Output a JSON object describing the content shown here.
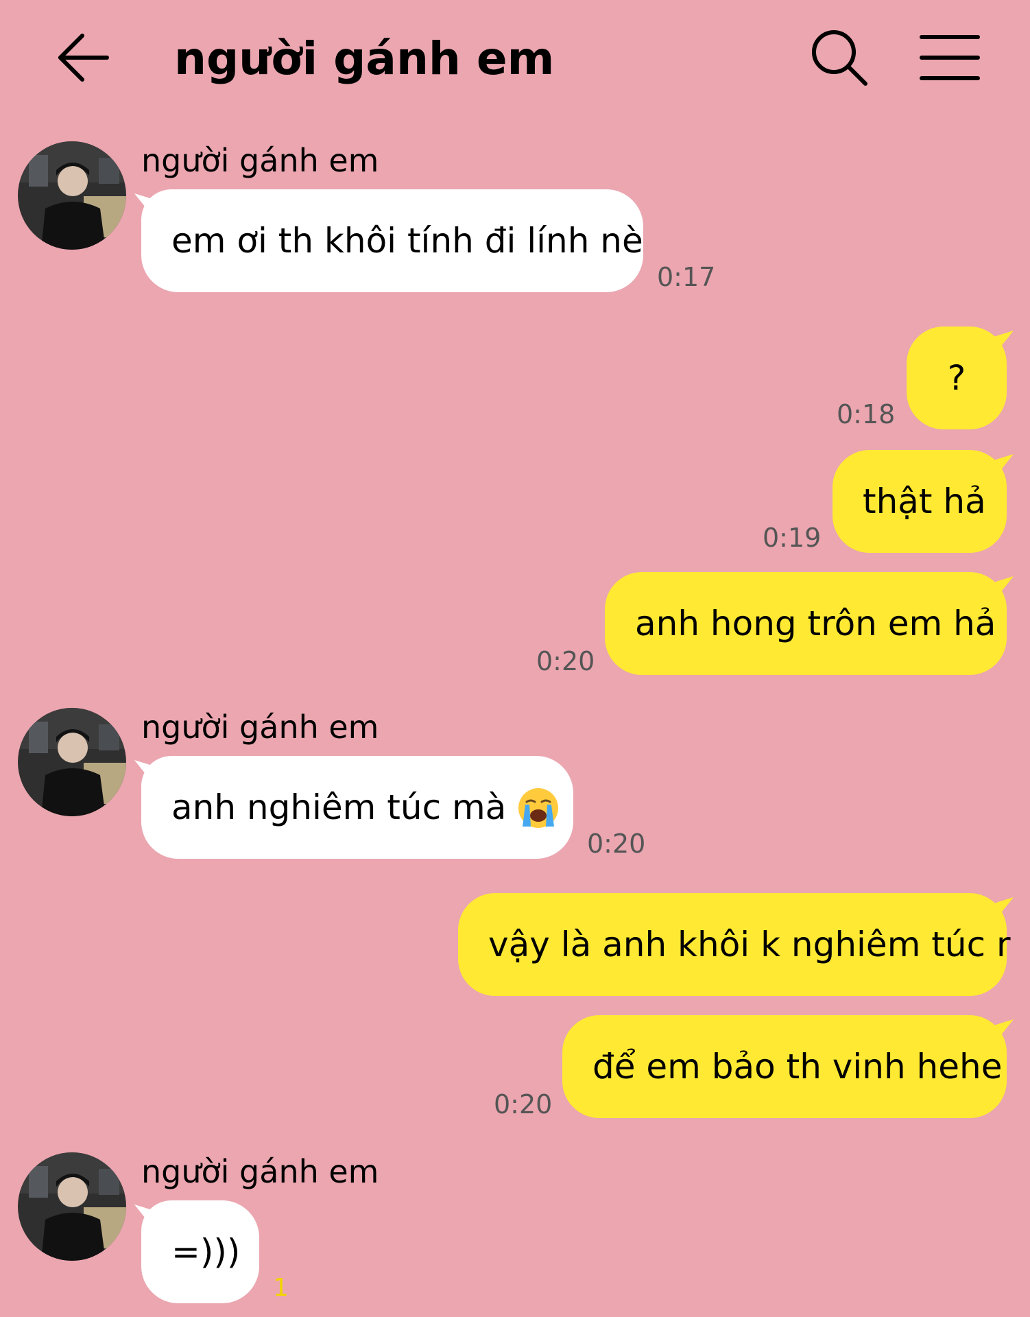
{
  "header": {
    "title": "người gánh em",
    "back_icon": "arrow-left-icon",
    "search_icon": "search-icon",
    "menu_icon": "hamburger-menu-icon"
  },
  "colors": {
    "background": "#eba6b0",
    "incoming_bubble": "#ffffff",
    "outgoing_bubble": "#ffe933",
    "timestamp": "#555555",
    "unread_count": "#f2d400"
  },
  "messages": [
    {
      "direction": "in",
      "sender": "người gánh em",
      "text": "em ơi th khôi tính đi lính nè",
      "time": "0:17"
    },
    {
      "direction": "out",
      "text": "?",
      "time": "0:18"
    },
    {
      "direction": "out",
      "text": "thật hả",
      "time": "0:19"
    },
    {
      "direction": "out",
      "text": "anh hong trôn em hả",
      "time": "0:20"
    },
    {
      "direction": "in",
      "sender": "người gánh em",
      "text": "anh nghiêm túc mà",
      "emoji": "loudly-crying-face-emoji",
      "time": "0:20"
    },
    {
      "direction": "out",
      "text": "vậy là anh khôi k nghiêm túc r",
      "time": ""
    },
    {
      "direction": "out",
      "text": "để em bảo th vinh hehe",
      "time": "0:20"
    },
    {
      "direction": "in",
      "sender": "người gánh em",
      "text": "=)))",
      "unread": "1"
    }
  ]
}
